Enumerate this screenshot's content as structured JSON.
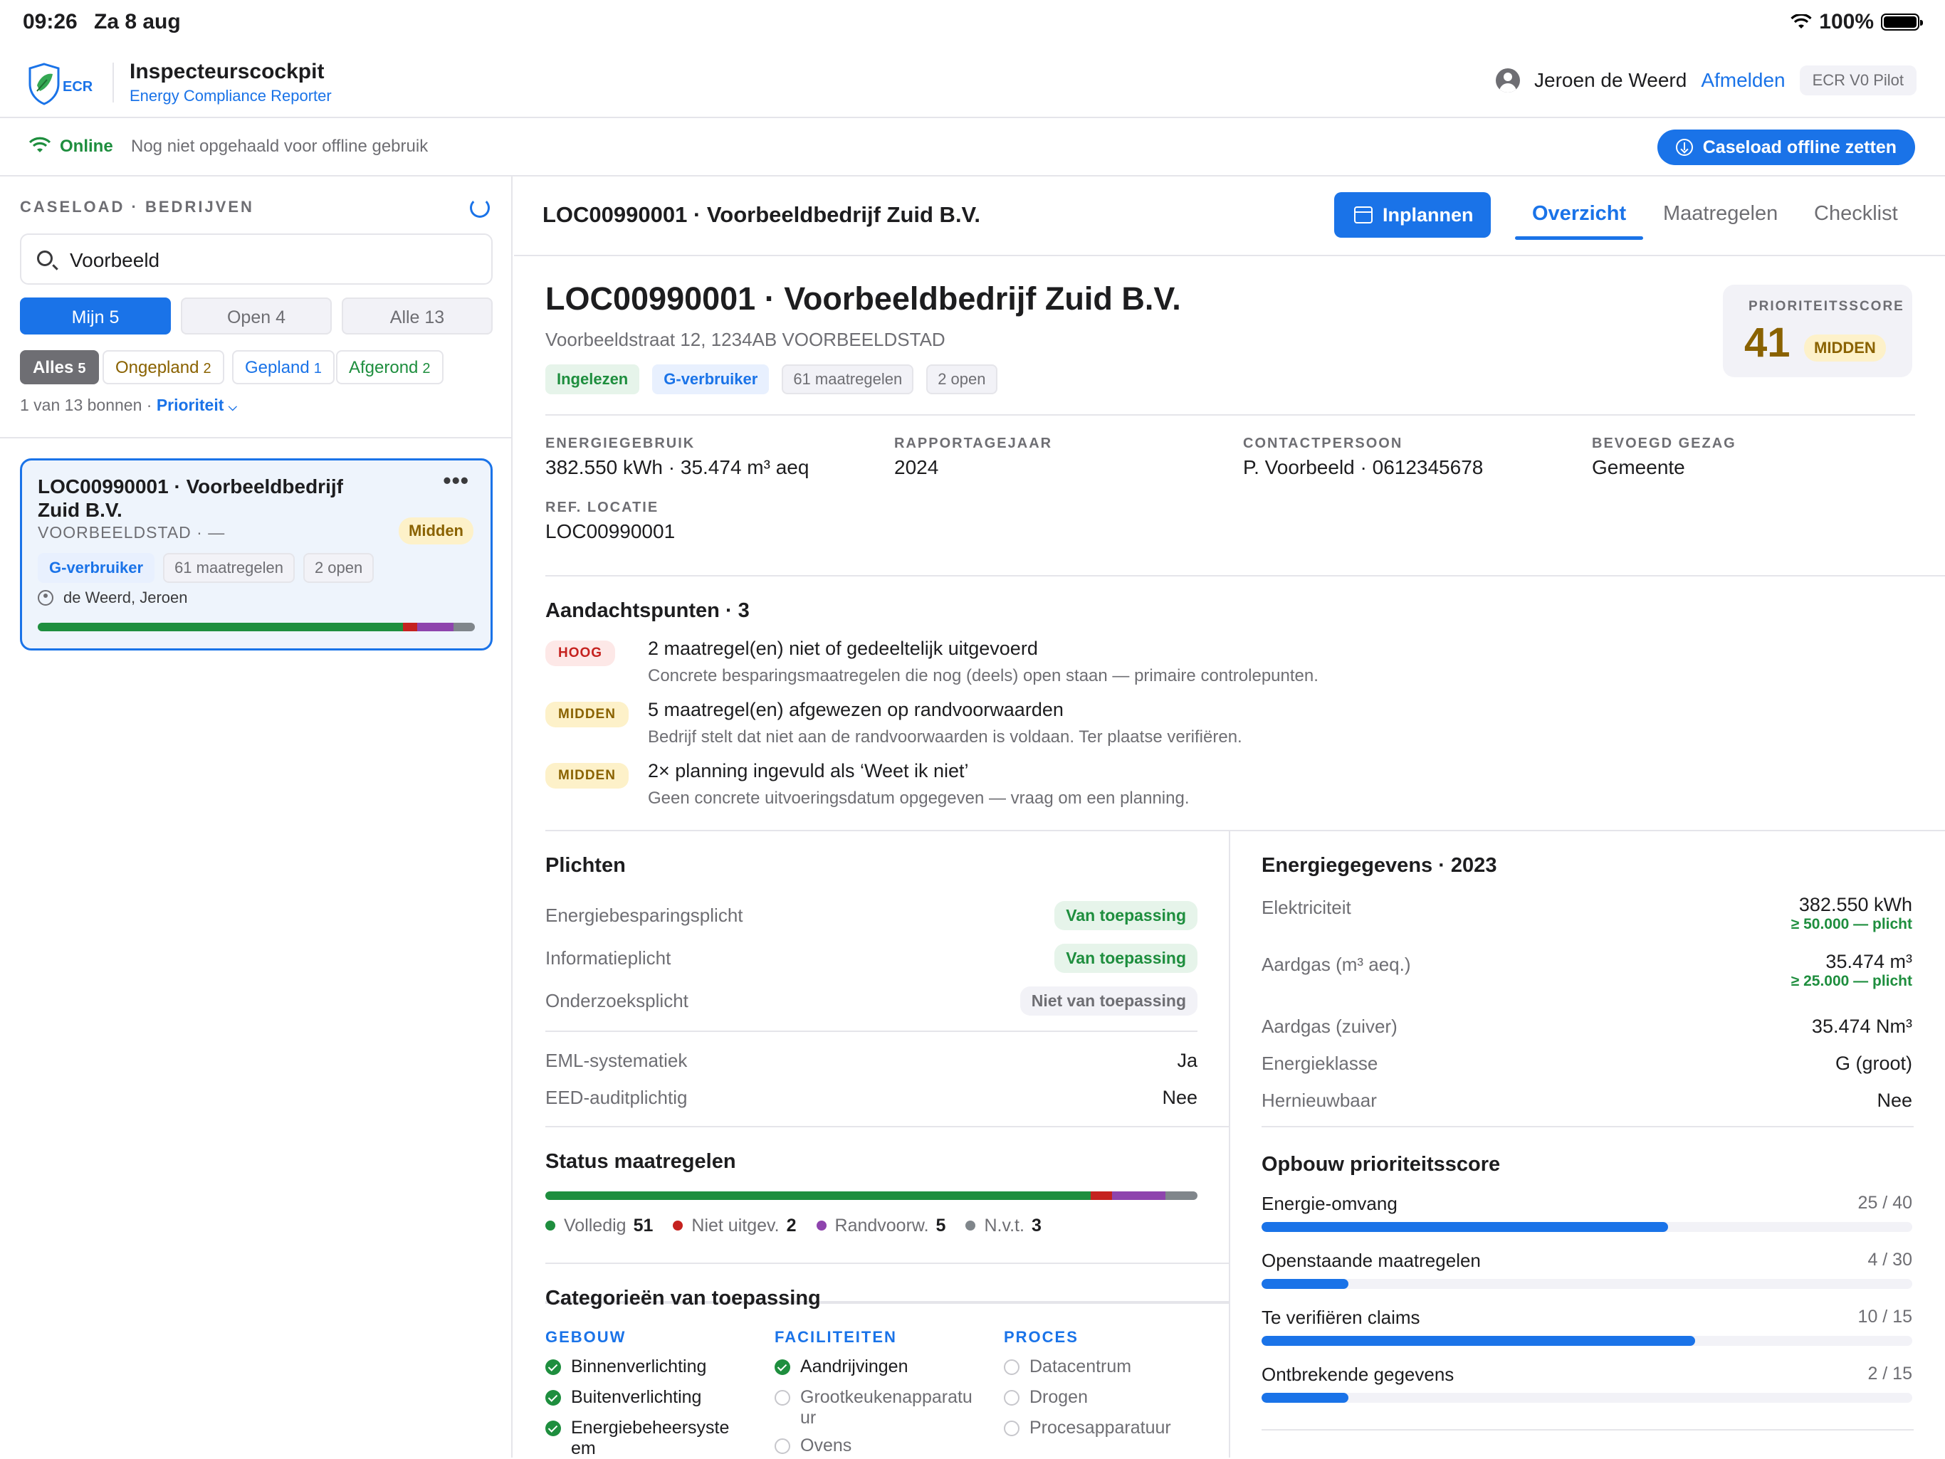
{
  "status_bar": {
    "time": "09:26",
    "date": "Za 8 aug",
    "battery": "100%"
  },
  "header": {
    "logo_text": "ECR",
    "title": "Inspecteurscockpit",
    "subtitle": "Energy Compliance Reporter",
    "user_name": "Jeroen de Weerd",
    "logout_label": "Afmelden",
    "version": "ECR V0 Pilot"
  },
  "connection": {
    "status": "Online",
    "message": "Nog niet opgehaald voor offline gebruik",
    "offline_button": "Caseload offline zetten"
  },
  "sidebar": {
    "title": "CASELOAD · BEDRIJVEN",
    "search_value": "Voorbeeld",
    "segments": [
      {
        "label": "Mijn 5",
        "active": true
      },
      {
        "label": "Open 4",
        "active": false
      },
      {
        "label": "Alle 13",
        "active": false
      }
    ],
    "filters": [
      {
        "label": "Alles",
        "count": "5",
        "color": "#ffffff"
      },
      {
        "label": "Ongepland",
        "count": "2",
        "color": "#8a6200"
      },
      {
        "label": "Gepland",
        "count": "1",
        "color": "#1a73e8"
      },
      {
        "label": "Afgerond",
        "count": "2",
        "color": "#1e8e3e"
      }
    ],
    "result_text": "1 van 13 bonnen ·",
    "sort_label": "Prioriteit",
    "card": {
      "title": "LOC00990001 · Voorbeeldbedrijf Zuid B.V.",
      "menu": "•••",
      "priority": "Midden",
      "city": "VOORBEELDSTAD · —",
      "tags": [
        "G-verbruiker",
        "61 maatregelen",
        "2 open"
      ],
      "assignee": "de Weerd, Jeroen"
    }
  },
  "main": {
    "header_title": "LOC00990001 · Voorbeeldbedrijf Zuid B.V.",
    "plan_button": "Inplannen",
    "tabs": [
      {
        "label": "Overzicht",
        "active": true
      },
      {
        "label": "Maatregelen",
        "active": false
      },
      {
        "label": "Checklist",
        "active": false
      }
    ],
    "title": "LOC00990001 · Voorbeeldbedrijf Zuid B.V.",
    "address": "Voorbeeldstraat 12, 1234AB  VOORBEELDSTAD",
    "tags": [
      "Ingelezen",
      "G-verbruiker",
      "61 maatregelen",
      "2 open"
    ],
    "score": {
      "label": "PRIORITEITSSCORE",
      "value": "41",
      "level": "MIDDEN"
    },
    "facts": [
      {
        "label": "ENERGIEGEBRUIK",
        "value": "382.550 kWh · 35.474 m³ aeq"
      },
      {
        "label": "RAPPORTAGEJAAR",
        "value": "2024"
      },
      {
        "label": "CONTACTPERSOON",
        "value": "P. Voorbeeld · 0612345678"
      },
      {
        "label": "BEVOEGD GEZAG",
        "value": "Gemeente"
      },
      {
        "label": "REF. LOCATIE",
        "value": "LOC00990001"
      }
    ],
    "attention": {
      "title": "Aandachtspunten · 3",
      "items": [
        {
          "badge": "HOOG",
          "title": "2 maatregel(en) niet of gedeeltelijk uitgevoerd",
          "desc": "Concrete besparingsmaatregelen die nog (deels) open staan — primaire controlepunten."
        },
        {
          "badge": "MIDDEN",
          "title": "5 maatregel(en) afgewezen op randvoorwaarden",
          "desc": "Bedrijf stelt dat niet aan de randvoorwaarden is voldaan. Ter plaatse verifiëren."
        },
        {
          "badge": "MIDDEN",
          "title": "2× planning ingevuld als ‘Weet ik niet’",
          "desc": "Geen concrete uitvoeringsdatum opgegeven — vraag om een planning."
        }
      ]
    },
    "duties": {
      "title": "Plichten",
      "rows": [
        {
          "label": "Energiebesparingsplicht",
          "value": "Van toepassing"
        },
        {
          "label": "Informatieplicht",
          "value": "Van toepassing"
        },
        {
          "label": "Onderzoeksplicht",
          "value": "Niet van toepassing"
        }
      ],
      "extra": [
        {
          "label": "EML-systematiek",
          "value": "Ja"
        },
        {
          "label": "EED-auditplichtig",
          "value": "Nee"
        }
      ]
    },
    "measures_status": {
      "title": "Status maatregelen",
      "items": [
        {
          "label": "Volledig",
          "count": 51,
          "color": "#1e8e3e"
        },
        {
          "label": "Niet uitgev.",
          "count": 2,
          "color": "#c5221f"
        },
        {
          "label": "Randvoorw.",
          "count": 5,
          "color": "#8e44ad"
        },
        {
          "label": "N.v.t.",
          "count": 3,
          "color": "#80868b"
        }
      ]
    },
    "categories": {
      "title": "Categorieën van toepassing",
      "groups": [
        {
          "name": "GEBOUW",
          "items": [
            {
              "label": "Binnenverlichting",
              "checked": true
            },
            {
              "label": "Buitenverlichting",
              "checked": true
            },
            {
              "label": "Energiebeheersysteem",
              "checked": true
            }
          ]
        },
        {
          "name": "FACILITEITEN",
          "items": [
            {
              "label": "Aandrijvingen",
              "checked": true
            },
            {
              "label": "Grootkeukenapparatuur",
              "checked": false
            },
            {
              "label": "Ovens",
              "checked": false
            }
          ]
        },
        {
          "name": "PROCES",
          "items": [
            {
              "label": "Datacentrum",
              "checked": false
            },
            {
              "label": "Drogen",
              "checked": false
            },
            {
              "label": "Procesapparatuur",
              "checked": false
            }
          ]
        }
      ]
    },
    "energy": {
      "title": "Energiegegevens · 2023",
      "rows": [
        {
          "label": "Elektriciteit",
          "value": "382.550 kWh",
          "sub": "≥ 50.000 — plicht"
        },
        {
          "label": "Aardgas (m³ aeq.)",
          "value": "35.474 m³",
          "sub": "≥ 25.000 — plicht"
        },
        {
          "label": "Aardgas (zuiver)",
          "value": "35.474 Nm³",
          "sub": ""
        },
        {
          "label": "Energieklasse",
          "value": "G (groot)",
          "sub": ""
        },
        {
          "label": "Hernieuwbaar",
          "value": "Nee",
          "sub": ""
        }
      ]
    },
    "score_breakdown": {
      "title": "Opbouw prioriteitsscore",
      "items": [
        {
          "label": "Energie-omvang",
          "value": "25 / 40",
          "fraction": 0.625
        },
        {
          "label": "Openstaande maatregelen",
          "value": "4 / 30",
          "fraction": 0.1333
        },
        {
          "label": "Te verifiëren claims",
          "value": "10 / 15",
          "fraction": 0.6667
        },
        {
          "label": "Ontbrekende gegevens",
          "value": "2 / 15",
          "fraction": 0.1333
        }
      ]
    }
  }
}
